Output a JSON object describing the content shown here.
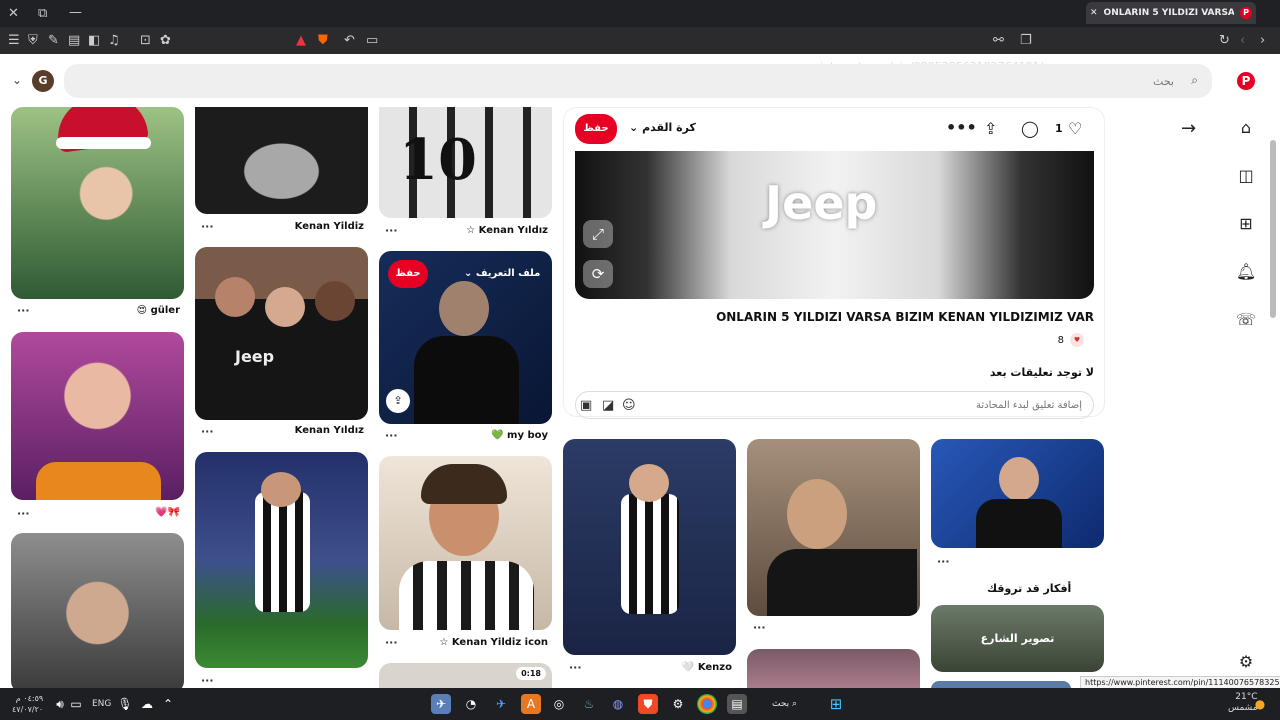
{
  "browser": {
    "tab_title": "ONLARIN 5 YILDIZI VARSA BIZIM KENAN YILDIZIMIZ VAR",
    "url": "pinterest.com/pin/898538563182764101/",
    "status_url": "https://www.pinterest.com/pin/1114007657832577414/"
  },
  "header": {
    "search_placeholder": "بحث",
    "avatar_letter": "G"
  },
  "pins": [
    {
      "title": "güler 😍",
      "color": "#6b8a57"
    },
    {
      "title": "🎀💗",
      "color": "#8c4a86"
    },
    {
      "title": "",
      "color": "#6e6e6e"
    },
    {
      "title": "Kenan Yildiz",
      "color": "#4b4b4b"
    },
    {
      "title": "Kenan Yıldız",
      "color": "#2f2f36"
    },
    {
      "title": "",
      "color": "#2c3556"
    },
    {
      "title": "Kenan Yıldız ☆",
      "color": "#d6d6d6"
    },
    {
      "title": "my boy 💚",
      "color": "#1f3a66"
    },
    {
      "title": "Kenan Yildiz icon ☆",
      "color": "#6a5648"
    },
    {
      "title": "Kenzo 🤍",
      "color": "#3a4a6b"
    },
    {
      "title": "",
      "color": "#8c7a6a"
    },
    {
      "title": "",
      "color": "#1f3f8a"
    }
  ],
  "hover_pin": {
    "save_label": "حفظ",
    "profile_label": "ملف التعريف"
  },
  "video_duration": "0:18",
  "detail": {
    "save_label": "حفظ",
    "board_name": "كرة القدم",
    "like_count": "1",
    "title": "ONLARIN 5 YILDIZI VARSA BIZIM KENAN YILDIZIMIZ VAR",
    "reaction_count": "8",
    "no_comments": "لا توجد تعليقات بعد",
    "comment_placeholder": "إضافة تعليق لبدء المحادثة"
  },
  "ideas_heading": "أفكار قد تروقك",
  "idea_card_label": "تصوير الشارع",
  "taskbar": {
    "lang": "ENG",
    "search_label": "بحث",
    "time": "٠٤:٥٩ م",
    "date": "٤٧/٠٧/٢٠",
    "weather_temp": "21°C",
    "weather_desc": "مشمس"
  }
}
